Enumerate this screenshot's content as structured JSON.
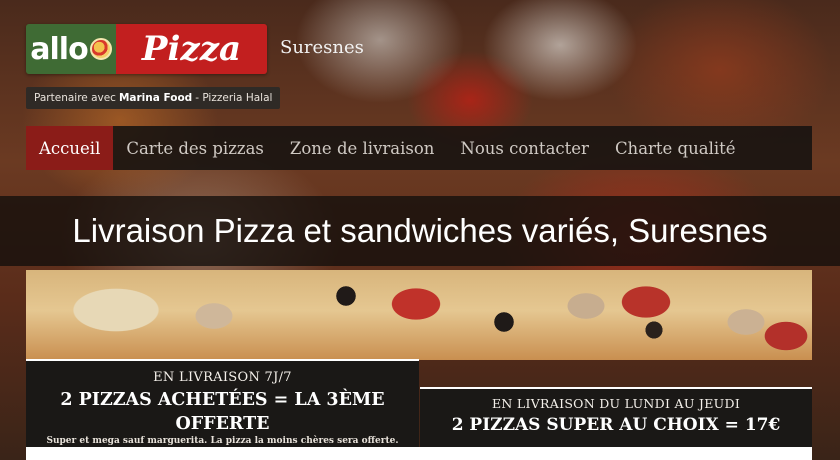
{
  "header": {
    "logo_left": "allo",
    "logo_right": "Pizza",
    "city": "Suresnes",
    "partner_prefix": "Partenaire avec",
    "partner_name": "Marina Food",
    "partner_suffix": "- Pizzeria Halal"
  },
  "nav": {
    "items": [
      {
        "label": "Accueil",
        "active": true
      },
      {
        "label": "Carte des pizzas",
        "active": false
      },
      {
        "label": "Zone de livraison",
        "active": false
      },
      {
        "label": "Nous contacter",
        "active": false
      },
      {
        "label": "Charte qualité",
        "active": false
      }
    ]
  },
  "page_title": "Livraison Pizza et sandwiches variés, Suresnes",
  "promos": {
    "left": {
      "head": "EN LIVRAISON 7J/7",
      "offer_line1": "2 PIZZAS ACHETÉES = LA 3ÈME",
      "offer_line2": "OFFERTE",
      "fine_print": "Super et mega sauf marguerita. La pizza la moins chères sera offerte."
    },
    "right": {
      "head": "EN LIVRAISON DU LUNDI AU JEUDI",
      "offer": "2 PIZZAS SUPER AU CHOIX = 17€"
    }
  },
  "colors": {
    "brand_green": "#3f6b34",
    "brand_red": "#c21f1f",
    "nav_active": "#8b1c18",
    "nav_bg": "#161210"
  }
}
